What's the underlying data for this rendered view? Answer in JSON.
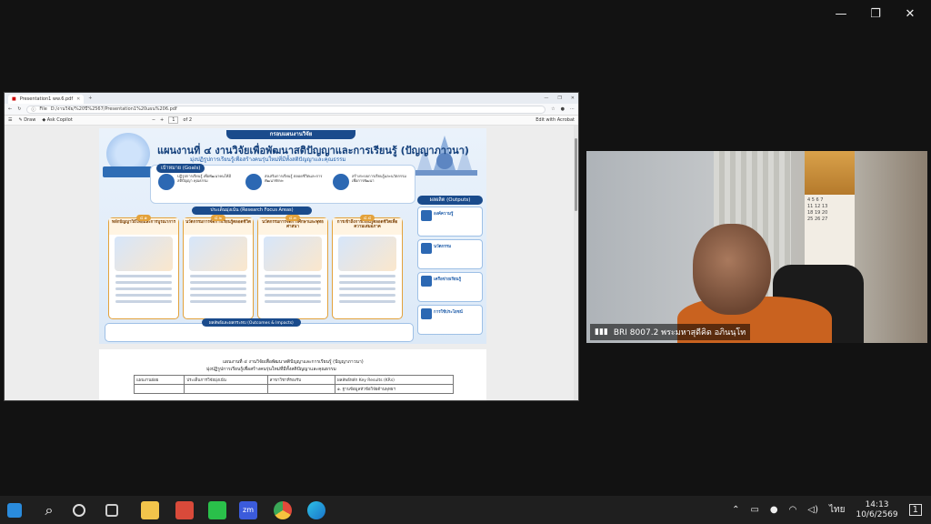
{
  "window_controls": {
    "minimize": "—",
    "maximize": "❐",
    "close": "✕"
  },
  "browser": {
    "tab_title": "Presentation1 ww.6.pdf",
    "file_label": "File",
    "url": "D:/งานวิจัย/%20ปี%2567/Presentation1%20แผน%206.pdf",
    "pdf_toolbar": {
      "draw": "Draw",
      "ask_copilot": "Ask Copilot",
      "page": "1",
      "of_pages": "of 2",
      "edit": "Edit with Acrobat"
    }
  },
  "slide": {
    "banner": "กรอบแผนงานวิจัย",
    "title": "แผนงานที่ ๔ งานวิจัยเพื่อพัฒนาสติปัญญาและการเรียนรู้ (ปัญญาภาวนา)",
    "subtitle": "มุ่งปฏิรูปการเรียนรู้เพื่อสร้างคนรุ่นใหม่ที่มีทั้งสติปัญญาและคุณธรรม",
    "goals_label": "เป้าหมาย (Goals)",
    "goals": [
      "ปฏิรูปการเรียนรู้ เพื่อพัฒนาคนให้มีสติปัญญา คุณธรรม",
      "ส่งเสริมการเรียนรู้ ตลอดชีวิตและการพัฒนาทักษะ",
      "สร้างระบบการเรียนรู้และนวัตกรรมเพื่อการพัฒนา"
    ],
    "focus_label": "ประเด็นมุ่งเน้น (Research Focus Areas)",
    "focus": [
      {
        "num": "๔.๑",
        "title": "หลักปัญญาวิถีไทยและการบูรณาการ"
      },
      {
        "num": "๔.๒",
        "title": "นวัตกรรมการจัดการเรียนรู้ตลอดชีวิต"
      },
      {
        "num": "๔.๓",
        "title": "นวัตกรรมการจัดการศึกษาและพุทธศาสนา"
      },
      {
        "num": "๔.๔",
        "title": "การเข้าถึงการเรียนรู้ตลอดชีวิตเพื่อความเสมอภาค"
      }
    ],
    "outputs_label": "ผลผลิต (Outputs)",
    "outputs": [
      "องค์ความรู้",
      "นวัตกรรม",
      "เครือข่ายเรียนรู้",
      "การใช้ประโยชน์"
    ],
    "outcomes_label": "ผลลัพธ์และผลกระทบ (Outcomes & Impacts)"
  },
  "doc": {
    "title": "แผนงานที่ ๔ งานวิจัยเพื่อพัฒนาสติปัญญาและการเรียนรู้ (ปัญญาภาวนา)",
    "subtitle": "มุ่งปฏิรูปการเรียนรู้เพื่อสร้างคนรุ่นใหม่ที่มีทั้งสติปัญญาและคุณธรรม",
    "headers": [
      "แผนงานย่อย",
      "ประเด็นการวิจัยมุ่งเน้น",
      "สาขาวิชาที่รองรับ",
      "ผลลัพธ์หลัก Key Results (KRs)"
    ],
    "row_text": "๑. ฐานข้อมูลหัวข้อวิจัยด้านพุทธฯ"
  },
  "video": {
    "name": "BRI 8007.2 พระมหาสุดีคิด อภินนฺโท"
  },
  "taskbar": {
    "lang": "ไทย",
    "time": "14:13",
    "date": "10/6/2569",
    "notifications": "1"
  }
}
